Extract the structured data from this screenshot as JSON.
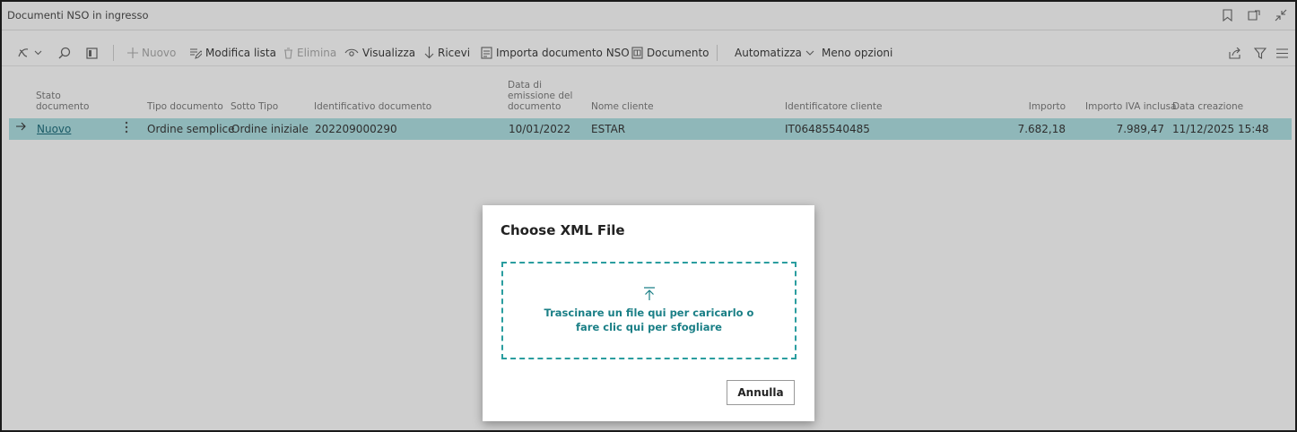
{
  "window": {
    "title": "Documenti NSO in ingresso",
    "icons": [
      "bookmark-icon",
      "open-new-window-icon",
      "collapse-icon"
    ]
  },
  "toolbar": {
    "new_label": "Nuovo",
    "edit_list_label": "Modifica lista",
    "delete_label": "Elimina",
    "view_label": "Visualizza",
    "receive_label": "Ricevi",
    "import_label": "Importa documento NSO",
    "document_label": "Documento",
    "automate_label": "Automatizza",
    "less_options_label": "Meno opzioni"
  },
  "table": {
    "headers": {
      "stato": [
        "Stato",
        "documento"
      ],
      "tipo": "Tipo documento",
      "sotto_tipo": "Sotto Tipo",
      "identificativo": "Identificativo documento",
      "data_emissione": [
        "Data di",
        "emissione del",
        "documento"
      ],
      "nome_cliente": "Nome cliente",
      "identificatore_cliente": "Identificatore cliente",
      "importo": "Importo",
      "importo_iva": "Importo IVA inclusa",
      "data_creazione": "Data creazione"
    },
    "rows": [
      {
        "stato": "Nuovo",
        "tipo": "Ordine semplice",
        "sotto_tipo": "Ordine iniziale",
        "identificativo": "202209000290",
        "data_emissione": "10/01/2022",
        "nome_cliente": "ESTAR",
        "identificatore_cliente": "IT06485540485",
        "importo": "7.682,18",
        "importo_iva": "7.989,47",
        "data_creazione": "11/12/2025 15:48"
      }
    ]
  },
  "dialog": {
    "title": "Choose XML File",
    "drop_text_line1": "Trascinare un file qui per caricarlo o",
    "drop_text_line2": "fare clic qui per sfogliare",
    "cancel_label": "Annulla"
  },
  "colors": {
    "accent": "#2a9d9f",
    "selected_row": "#8fb7b9",
    "link": "#1a5a66"
  }
}
